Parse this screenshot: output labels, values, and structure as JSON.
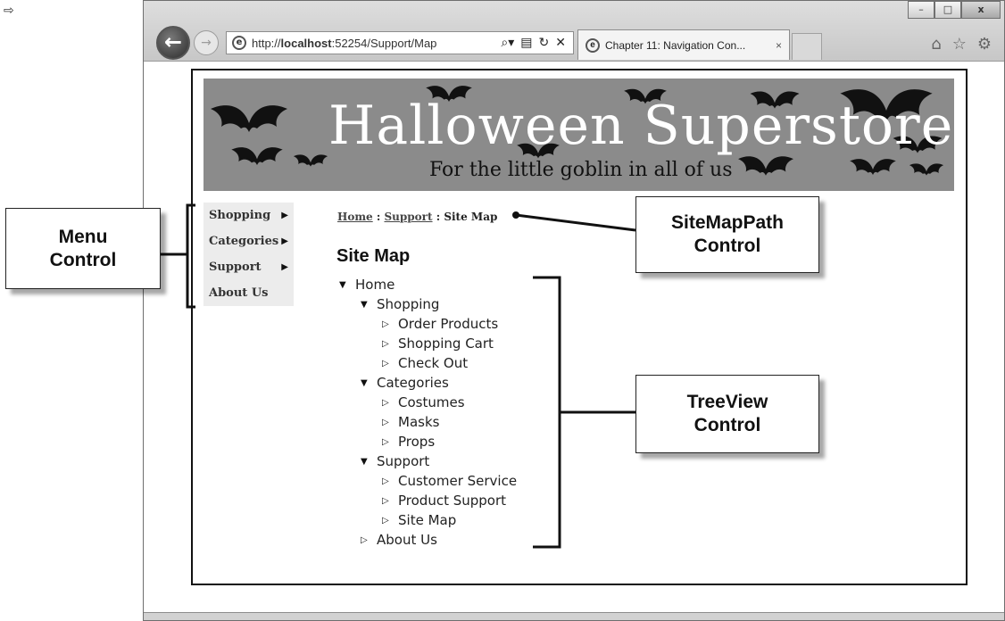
{
  "browser": {
    "url_prefix": "http://",
    "url_host": "localhost",
    "url_rest": ":52254/Support/Map",
    "tab_title": "Chapter 11: Navigation Con...",
    "tab_close": "×",
    "window_buttons": {
      "minimize": "–",
      "maximize": "□",
      "close": "x"
    },
    "right_icons": [
      "home-icon",
      "star-icon",
      "gear-icon"
    ]
  },
  "banner": {
    "title": "Halloween Superstore",
    "subtitle": "For the little goblin in all of us"
  },
  "menu": {
    "items": [
      {
        "label": "Shopping",
        "has_submenu": true
      },
      {
        "label": "Categories",
        "has_submenu": true
      },
      {
        "label": "Support",
        "has_submenu": true
      },
      {
        "label": "About Us",
        "has_submenu": false
      }
    ]
  },
  "breadcrumb": {
    "home": "Home",
    "sep1": " : ",
    "support": "Support",
    "sep2": " : ",
    "current": "Site Map"
  },
  "page_title": "Site Map",
  "tree": {
    "root": {
      "label": "Home",
      "expanded": true
    },
    "nodes": [
      {
        "label": "Shopping",
        "expanded": true,
        "level": 1
      },
      {
        "label": "Order Products",
        "expanded": false,
        "level": 2
      },
      {
        "label": "Shopping Cart",
        "expanded": false,
        "level": 2
      },
      {
        "label": "Check Out",
        "expanded": false,
        "level": 2
      },
      {
        "label": "Categories",
        "expanded": true,
        "level": 1
      },
      {
        "label": "Costumes",
        "expanded": false,
        "level": 2
      },
      {
        "label": "Masks",
        "expanded": false,
        "level": 2
      },
      {
        "label": "Props",
        "expanded": false,
        "level": 2
      },
      {
        "label": "Support",
        "expanded": true,
        "level": 1
      },
      {
        "label": "Customer Service",
        "expanded": false,
        "level": 2
      },
      {
        "label": "Product Support",
        "expanded": false,
        "level": 2
      },
      {
        "label": "Site Map",
        "expanded": false,
        "level": 2
      },
      {
        "label": "About Us",
        "expanded": false,
        "level": 1
      }
    ]
  },
  "callouts": {
    "menu": {
      "line1": "Menu",
      "line2": "Control"
    },
    "sitemappath": {
      "line1": "SiteMapPath",
      "line2": "Control"
    },
    "treeview": {
      "line1": "TreeView",
      "line2": "Control"
    }
  }
}
